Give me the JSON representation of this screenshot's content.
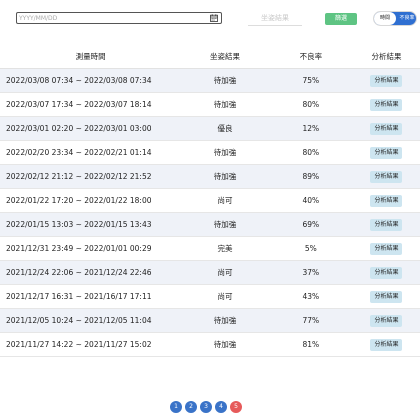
{
  "filters": {
    "date_placeholder": "YYYY/MM/DD",
    "posture_select_placeholder": "坐姿結果",
    "filter_button_label": "篩選",
    "toggle": {
      "active_label": "時間",
      "inactive_label": "不良率"
    }
  },
  "table": {
    "headers": [
      "測量時間",
      "坐姿結果",
      "不良率",
      "分析結果"
    ],
    "rows": [
      {
        "time": "2022/03/08 07:34 ~ 2022/03/08 07:34",
        "result": "待加強",
        "rate": "75%",
        "action": "分析結果"
      },
      {
        "time": "2022/03/07 17:34 ~ 2022/03/07 18:14",
        "result": "待加強",
        "rate": "80%",
        "action": "分析結果"
      },
      {
        "time": "2022/03/01 02:20 ~ 2022/03/01 03:00",
        "result": "優良",
        "rate": "12%",
        "action": "分析結果"
      },
      {
        "time": "2022/02/20 23:34 ~ 2022/02/21 01:14",
        "result": "待加強",
        "rate": "80%",
        "action": "分析結果"
      },
      {
        "time": "2022/02/12 21:12 ~ 2022/02/12 21:52",
        "result": "待加強",
        "rate": "89%",
        "action": "分析結果"
      },
      {
        "time": "2022/01/22 17:20 ~ 2022/01/22 18:00",
        "result": "尚可",
        "rate": "40%",
        "action": "分析結果"
      },
      {
        "time": "2022/01/15 13:03 ~ 2022/01/15 13:43",
        "result": "待加強",
        "rate": "69%",
        "action": "分析結果"
      },
      {
        "time": "2021/12/31 23:49 ~ 2022/01/01 00:29",
        "result": "完美",
        "rate": "5%",
        "action": "分析結果"
      },
      {
        "time": "2021/12/24 22:06 ~ 2021/12/24 22:46",
        "result": "尚可",
        "rate": "37%",
        "action": "分析結果"
      },
      {
        "time": "2021/12/17 16:31 ~ 2021/16/17 17:11",
        "result": "尚可",
        "rate": "43%",
        "action": "分析結果"
      },
      {
        "time": "2021/12/05 10:24 ~ 2021/12/05 11:04",
        "result": "待加強",
        "rate": "77%",
        "action": "分析結果"
      },
      {
        "time": "2021/11/27 14:22 ~ 2021/11/27 15:02",
        "result": "待加強",
        "rate": "81%",
        "action": "分析結果"
      }
    ]
  },
  "pagination": {
    "pages": [
      "1",
      "2",
      "3",
      "4",
      "5"
    ],
    "current": "5"
  },
  "colors": {
    "filter_button": "#5ec483",
    "toggle_active": "#2f6fd1",
    "page_button": "#3a73c8",
    "page_current": "#e65a5a",
    "row_stripe": "#eff2f8",
    "analysis_button": "#cde5f0"
  },
  "icons": {
    "date_picker": "calendar-icon"
  }
}
